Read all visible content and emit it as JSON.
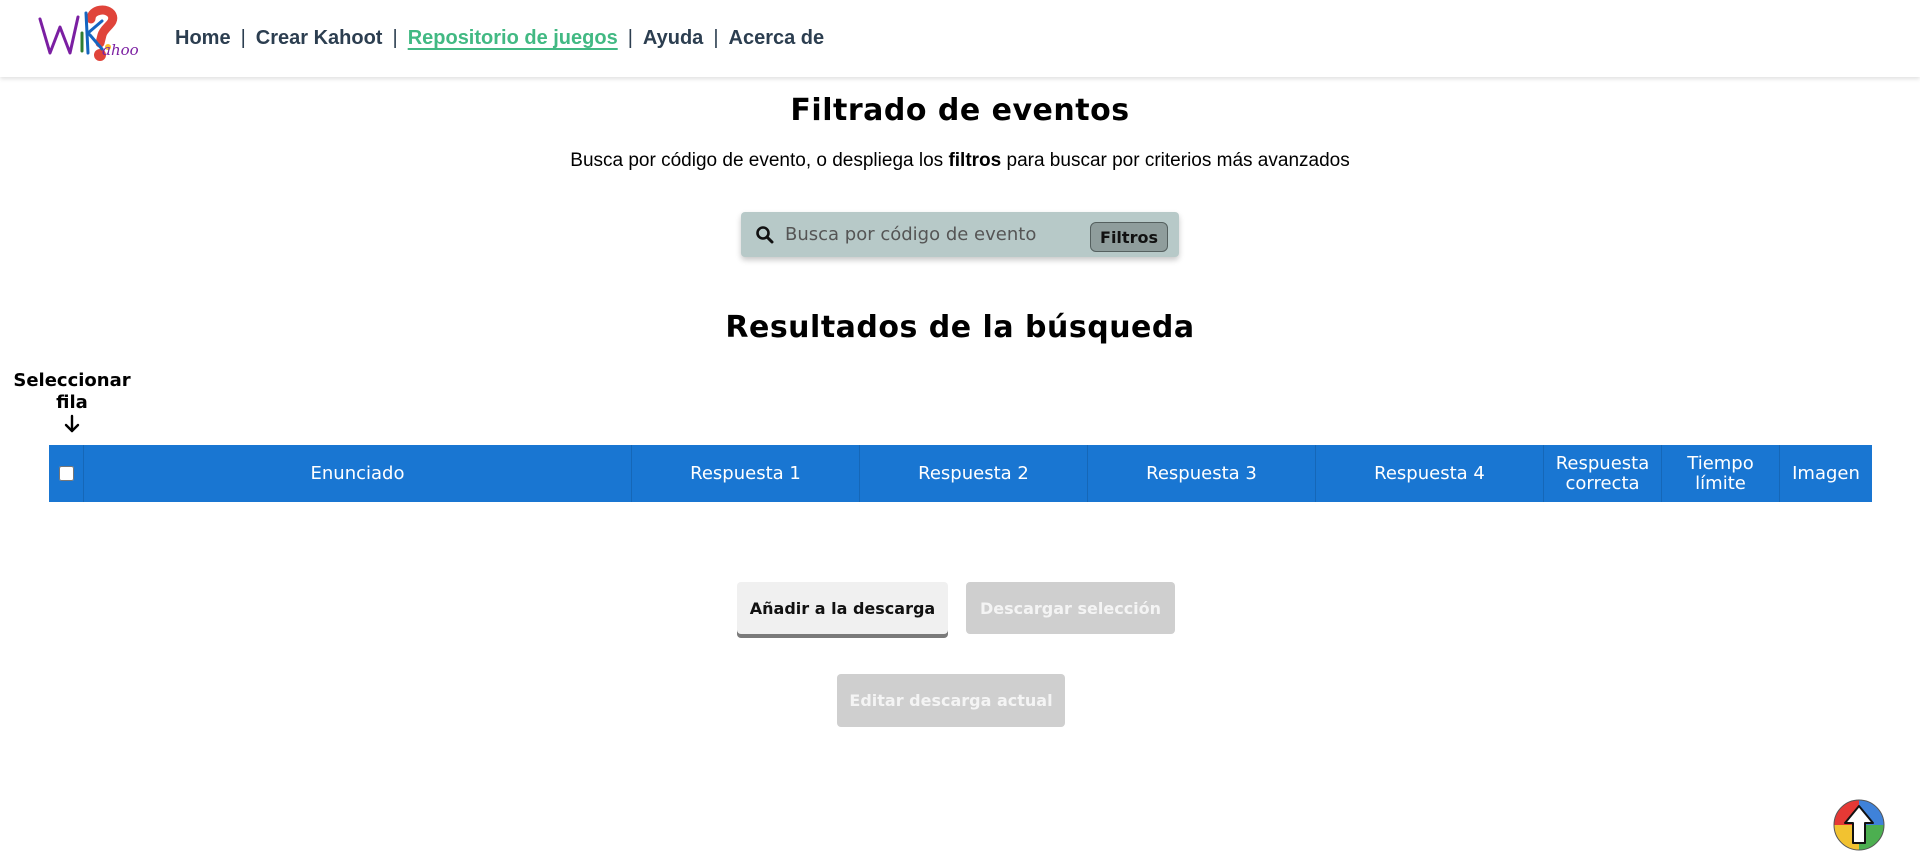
{
  "nav": {
    "logo_alt": "WiKahoot",
    "links": [
      {
        "label": "Home",
        "active": false
      },
      {
        "label": "Crear Kahoot",
        "active": false
      },
      {
        "label": "Repositorio de juegos",
        "active": true
      },
      {
        "label": "Ayuda",
        "active": false
      },
      {
        "label": "Acerca de",
        "active": false
      }
    ],
    "separator": "|"
  },
  "filter": {
    "title": "Filtrado de eventos",
    "subtitle_pre": "Busca por código de evento, o despliega los ",
    "subtitle_bold": "filtros",
    "subtitle_post": " para buscar por criterios más avanzados",
    "search_placeholder": "Busca por código de evento",
    "filter_button": "Filtros"
  },
  "results": {
    "title": "Resultados de la búsqueda",
    "select_label_line1": "Seleccionar",
    "select_label_line2": "fila",
    "columns": [
      "Enunciado",
      "Respuesta 1",
      "Respuesta 2",
      "Respuesta 3",
      "Respuesta 4",
      "Respuesta correcta",
      "Tiempo límite",
      "Imagen"
    ],
    "rows": []
  },
  "actions": {
    "add_to_download": "Añadir a la descarga",
    "download_selection": "Descargar selección",
    "edit_current_download": "Editar descarga actual"
  },
  "colors": {
    "nav_text": "#2c3e50",
    "nav_active": "#42b983",
    "table_header": "#1976d2",
    "search_bg": "#b7c9c8",
    "disabled_button": "#cfcfcf"
  }
}
